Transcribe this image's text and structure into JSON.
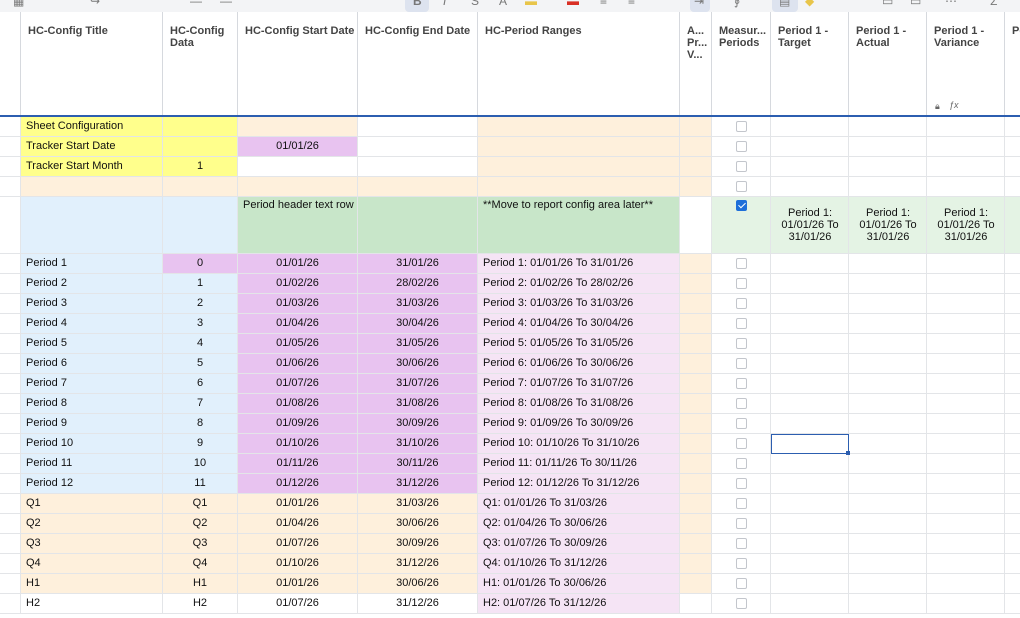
{
  "columns": [
    {
      "title": "",
      "width": 21
    },
    {
      "title": "HC-Config Title",
      "width": 142
    },
    {
      "title": "HC-Config Data",
      "width": 75
    },
    {
      "title": "HC-Config Start Date",
      "width": 120
    },
    {
      "title": "HC-Config End Date",
      "width": 120
    },
    {
      "title": "HC-Period Ranges",
      "width": 202
    },
    {
      "title": "A... Pr... V...",
      "width": 32
    },
    {
      "title": "Measur... Periods",
      "width": 59
    },
    {
      "title": "Period 1 - Target",
      "width": 78
    },
    {
      "title": "Period 1 - Actual",
      "width": 78
    },
    {
      "title": "Period 1 - Variance",
      "width": 78
    },
    {
      "title": "Pe Pr",
      "width": 40
    }
  ],
  "header_icons": {
    "lock": "lock-icon",
    "formula": "formula-icon"
  },
  "fills": {
    "yellow": "#ffff8c",
    "peach": "#fef0dc",
    "lavender": "#e8c3f0",
    "lightblue": "#e1f0fc",
    "green": "#c8e6c9",
    "pinklight": "#f5e4f5",
    "greenlight": "#e4f3e4",
    "white": "#ffffff"
  },
  "period_header_label": "Period 1: 01/01/26 To 31/01/26",
  "rows": [
    {
      "h": 20,
      "cb": false,
      "period": false,
      "cells": [
        {
          "t": "",
          "f": "white"
        },
        {
          "t": "Sheet Configuration",
          "f": "yellow",
          "a": "left"
        },
        {
          "t": "",
          "f": "yellow"
        },
        {
          "t": "",
          "f": "peach"
        },
        {
          "t": "",
          "f": "white"
        },
        {
          "t": "",
          "f": "peach"
        },
        {
          "t": "",
          "f": "peach"
        }
      ]
    },
    {
      "h": 20,
      "cb": false,
      "period": false,
      "cells": [
        {
          "t": "",
          "f": "white"
        },
        {
          "t": "Tracker Start Date",
          "f": "yellow",
          "a": "left"
        },
        {
          "t": "",
          "f": "yellow"
        },
        {
          "t": "01/01/26",
          "f": "lavender",
          "a": "center"
        },
        {
          "t": "",
          "f": "white"
        },
        {
          "t": "",
          "f": "peach"
        },
        {
          "t": "",
          "f": "peach"
        }
      ]
    },
    {
      "h": 20,
      "cb": false,
      "period": false,
      "cells": [
        {
          "t": "",
          "f": "white"
        },
        {
          "t": "Tracker Start Month",
          "f": "yellow",
          "a": "left"
        },
        {
          "t": "1",
          "f": "yellow",
          "a": "center"
        },
        {
          "t": "",
          "f": "white"
        },
        {
          "t": "",
          "f": "white"
        },
        {
          "t": "",
          "f": "peach"
        },
        {
          "t": "",
          "f": "peach"
        }
      ]
    },
    {
      "h": 20,
      "cb": false,
      "period": false,
      "cells": [
        {
          "t": "",
          "f": "white"
        },
        {
          "t": "",
          "f": "peach"
        },
        {
          "t": "",
          "f": "peach"
        },
        {
          "t": "",
          "f": "peach"
        },
        {
          "t": "",
          "f": "peach"
        },
        {
          "t": "",
          "f": "peach"
        },
        {
          "t": "",
          "f": "peach"
        }
      ]
    },
    {
      "h": 57,
      "cb": true,
      "period": true,
      "cells": [
        {
          "t": "",
          "f": "white"
        },
        {
          "t": "",
          "f": "lightblue"
        },
        {
          "t": "",
          "f": "lightblue"
        },
        {
          "t": "Period header text row",
          "f": "green",
          "a": "top"
        },
        {
          "t": "",
          "f": "green"
        },
        {
          "t": "**Move to report config area later**",
          "f": "green",
          "a": "top"
        },
        {
          "t": "",
          "f": "white"
        },
        {
          "t": "",
          "f": "greenlight"
        },
        {
          "t": "",
          "f": "greenlight"
        },
        {
          "t": "",
          "f": "greenlight"
        },
        {
          "t": "",
          "f": "greenlight"
        },
        {
          "t": "",
          "f": "greenlight"
        }
      ]
    },
    {
      "h": 20,
      "cb": false,
      "period": false,
      "cells": [
        {
          "t": "",
          "f": "white"
        },
        {
          "t": "Period 1",
          "f": "lightblue",
          "a": "left"
        },
        {
          "t": "0",
          "f": "lavender",
          "a": "center"
        },
        {
          "t": "01/01/26",
          "f": "lavender",
          "a": "center"
        },
        {
          "t": "31/01/26",
          "f": "lavender",
          "a": "center"
        },
        {
          "t": "Period 1: 01/01/26 To 31/01/26",
          "f": "pinklight",
          "a": "left"
        },
        {
          "t": "",
          "f": "peach"
        }
      ]
    },
    {
      "h": 20,
      "cb": false,
      "period": false,
      "cells": [
        {
          "t": "",
          "f": "white"
        },
        {
          "t": "Period 2",
          "f": "lightblue",
          "a": "left"
        },
        {
          "t": "1",
          "f": "lightblue",
          "a": "center"
        },
        {
          "t": "01/02/26",
          "f": "lavender",
          "a": "center"
        },
        {
          "t": "28/02/26",
          "f": "lavender",
          "a": "center"
        },
        {
          "t": "Period 2: 01/02/26 To 28/02/26",
          "f": "pinklight",
          "a": "left"
        },
        {
          "t": "",
          "f": "peach"
        }
      ]
    },
    {
      "h": 20,
      "cb": false,
      "period": false,
      "cells": [
        {
          "t": "",
          "f": "white"
        },
        {
          "t": "Period 3",
          "f": "lightblue",
          "a": "left"
        },
        {
          "t": "2",
          "f": "lightblue",
          "a": "center"
        },
        {
          "t": "01/03/26",
          "f": "lavender",
          "a": "center"
        },
        {
          "t": "31/03/26",
          "f": "lavender",
          "a": "center"
        },
        {
          "t": "Period 3: 01/03/26 To 31/03/26",
          "f": "pinklight",
          "a": "left"
        },
        {
          "t": "",
          "f": "peach"
        }
      ]
    },
    {
      "h": 20,
      "cb": false,
      "period": false,
      "cells": [
        {
          "t": "",
          "f": "white"
        },
        {
          "t": "Period 4",
          "f": "lightblue",
          "a": "left"
        },
        {
          "t": "3",
          "f": "lightblue",
          "a": "center"
        },
        {
          "t": "01/04/26",
          "f": "lavender",
          "a": "center"
        },
        {
          "t": "30/04/26",
          "f": "lavender",
          "a": "center"
        },
        {
          "t": "Period 4: 01/04/26 To 30/04/26",
          "f": "pinklight",
          "a": "left"
        },
        {
          "t": "",
          "f": "peach"
        }
      ]
    },
    {
      "h": 20,
      "cb": false,
      "period": false,
      "cells": [
        {
          "t": "",
          "f": "white"
        },
        {
          "t": "Period 5",
          "f": "lightblue",
          "a": "left"
        },
        {
          "t": "4",
          "f": "lightblue",
          "a": "center"
        },
        {
          "t": "01/05/26",
          "f": "lavender",
          "a": "center"
        },
        {
          "t": "31/05/26",
          "f": "lavender",
          "a": "center"
        },
        {
          "t": "Period 5: 01/05/26 To 31/05/26",
          "f": "pinklight",
          "a": "left"
        },
        {
          "t": "",
          "f": "peach"
        }
      ]
    },
    {
      "h": 20,
      "cb": false,
      "period": false,
      "cells": [
        {
          "t": "",
          "f": "white"
        },
        {
          "t": "Period 6",
          "f": "lightblue",
          "a": "left"
        },
        {
          "t": "5",
          "f": "lightblue",
          "a": "center"
        },
        {
          "t": "01/06/26",
          "f": "lavender",
          "a": "center"
        },
        {
          "t": "30/06/26",
          "f": "lavender",
          "a": "center"
        },
        {
          "t": "Period 6: 01/06/26 To 30/06/26",
          "f": "pinklight",
          "a": "left"
        },
        {
          "t": "",
          "f": "peach"
        }
      ]
    },
    {
      "h": 20,
      "cb": false,
      "period": false,
      "cells": [
        {
          "t": "",
          "f": "white"
        },
        {
          "t": "Period 7",
          "f": "lightblue",
          "a": "left"
        },
        {
          "t": "6",
          "f": "lightblue",
          "a": "center"
        },
        {
          "t": "01/07/26",
          "f": "lavender",
          "a": "center"
        },
        {
          "t": "31/07/26",
          "f": "lavender",
          "a": "center"
        },
        {
          "t": "Period 7: 01/07/26 To 31/07/26",
          "f": "pinklight",
          "a": "left"
        },
        {
          "t": "",
          "f": "peach"
        }
      ]
    },
    {
      "h": 20,
      "cb": false,
      "period": false,
      "cells": [
        {
          "t": "",
          "f": "white"
        },
        {
          "t": "Period 8",
          "f": "lightblue",
          "a": "left"
        },
        {
          "t": "7",
          "f": "lightblue",
          "a": "center"
        },
        {
          "t": "01/08/26",
          "f": "lavender",
          "a": "center"
        },
        {
          "t": "31/08/26",
          "f": "lavender",
          "a": "center"
        },
        {
          "t": "Period 8: 01/08/26 To 31/08/26",
          "f": "pinklight",
          "a": "left"
        },
        {
          "t": "",
          "f": "peach"
        }
      ]
    },
    {
      "h": 20,
      "cb": false,
      "period": false,
      "cells": [
        {
          "t": "",
          "f": "white"
        },
        {
          "t": "Period 9",
          "f": "lightblue",
          "a": "left"
        },
        {
          "t": "8",
          "f": "lightblue",
          "a": "center"
        },
        {
          "t": "01/09/26",
          "f": "lavender",
          "a": "center"
        },
        {
          "t": "30/09/26",
          "f": "lavender",
          "a": "center"
        },
        {
          "t": "Period 9: 01/09/26 To 30/09/26",
          "f": "pinklight",
          "a": "left"
        },
        {
          "t": "",
          "f": "peach"
        }
      ]
    },
    {
      "h": 20,
      "cb": false,
      "period": false,
      "cells": [
        {
          "t": "",
          "f": "white"
        },
        {
          "t": "Period 10",
          "f": "lightblue",
          "a": "left"
        },
        {
          "t": "9",
          "f": "lightblue",
          "a": "center"
        },
        {
          "t": "01/10/26",
          "f": "lavender",
          "a": "center"
        },
        {
          "t": "31/10/26",
          "f": "lavender",
          "a": "center"
        },
        {
          "t": "Period 10: 01/10/26 To 31/10/26",
          "f": "pinklight",
          "a": "left"
        },
        {
          "t": "",
          "f": "peach"
        }
      ]
    },
    {
      "h": 20,
      "cb": false,
      "period": false,
      "cells": [
        {
          "t": "",
          "f": "white"
        },
        {
          "t": "Period 11",
          "f": "lightblue",
          "a": "left"
        },
        {
          "t": "10",
          "f": "lightblue",
          "a": "center"
        },
        {
          "t": "01/11/26",
          "f": "lavender",
          "a": "center"
        },
        {
          "t": "30/11/26",
          "f": "lavender",
          "a": "center"
        },
        {
          "t": "Period 11: 01/11/26 To 30/11/26",
          "f": "pinklight",
          "a": "left"
        },
        {
          "t": "",
          "f": "peach"
        }
      ]
    },
    {
      "h": 20,
      "cb": false,
      "period": false,
      "cells": [
        {
          "t": "",
          "f": "white"
        },
        {
          "t": "Period 12",
          "f": "lightblue",
          "a": "left"
        },
        {
          "t": "11",
          "f": "lightblue",
          "a": "center"
        },
        {
          "t": "01/12/26",
          "f": "lavender",
          "a": "center"
        },
        {
          "t": "31/12/26",
          "f": "lavender",
          "a": "center"
        },
        {
          "t": "Period 12: 01/12/26 To 31/12/26",
          "f": "pinklight",
          "a": "left"
        },
        {
          "t": "",
          "f": "peach"
        }
      ]
    },
    {
      "h": 20,
      "cb": false,
      "period": false,
      "cells": [
        {
          "t": "",
          "f": "white"
        },
        {
          "t": "Q1",
          "f": "peach",
          "a": "left"
        },
        {
          "t": "Q1",
          "f": "peach",
          "a": "center"
        },
        {
          "t": "01/01/26",
          "f": "peach",
          "a": "center"
        },
        {
          "t": "31/03/26",
          "f": "peach",
          "a": "center"
        },
        {
          "t": "Q1: 01/01/26 To 31/03/26",
          "f": "pinklight",
          "a": "left"
        },
        {
          "t": "",
          "f": "peach"
        }
      ]
    },
    {
      "h": 20,
      "cb": false,
      "period": false,
      "cells": [
        {
          "t": "",
          "f": "white"
        },
        {
          "t": "Q2",
          "f": "peach",
          "a": "left"
        },
        {
          "t": "Q2",
          "f": "peach",
          "a": "center"
        },
        {
          "t": "01/04/26",
          "f": "peach",
          "a": "center"
        },
        {
          "t": "30/06/26",
          "f": "peach",
          "a": "center"
        },
        {
          "t": "Q2: 01/04/26 To 30/06/26",
          "f": "pinklight",
          "a": "left"
        },
        {
          "t": "",
          "f": "peach"
        }
      ]
    },
    {
      "h": 20,
      "cb": false,
      "period": false,
      "cells": [
        {
          "t": "",
          "f": "white"
        },
        {
          "t": "Q3",
          "f": "peach",
          "a": "left"
        },
        {
          "t": "Q3",
          "f": "peach",
          "a": "center"
        },
        {
          "t": "01/07/26",
          "f": "peach",
          "a": "center"
        },
        {
          "t": "30/09/26",
          "f": "peach",
          "a": "center"
        },
        {
          "t": "Q3: 01/07/26 To 30/09/26",
          "f": "pinklight",
          "a": "left"
        },
        {
          "t": "",
          "f": "peach"
        }
      ]
    },
    {
      "h": 20,
      "cb": false,
      "period": false,
      "cells": [
        {
          "t": "",
          "f": "white"
        },
        {
          "t": "Q4",
          "f": "peach",
          "a": "left"
        },
        {
          "t": "Q4",
          "f": "peach",
          "a": "center"
        },
        {
          "t": "01/10/26",
          "f": "peach",
          "a": "center"
        },
        {
          "t": "31/12/26",
          "f": "peach",
          "a": "center"
        },
        {
          "t": "Q4: 01/10/26 To 31/12/26",
          "f": "pinklight",
          "a": "left"
        },
        {
          "t": "",
          "f": "peach"
        }
      ]
    },
    {
      "h": 20,
      "cb": false,
      "period": false,
      "cells": [
        {
          "t": "",
          "f": "white"
        },
        {
          "t": "H1",
          "f": "peach",
          "a": "left"
        },
        {
          "t": "H1",
          "f": "peach",
          "a": "center"
        },
        {
          "t": "01/01/26",
          "f": "peach",
          "a": "center"
        },
        {
          "t": "30/06/26",
          "f": "peach",
          "a": "center"
        },
        {
          "t": "H1: 01/01/26 To 30/06/26",
          "f": "pinklight",
          "a": "left"
        },
        {
          "t": "",
          "f": "peach"
        }
      ]
    },
    {
      "h": 20,
      "cb": false,
      "period": false,
      "cells": [
        {
          "t": "",
          "f": "white"
        },
        {
          "t": "H2",
          "f": "white",
          "a": "left"
        },
        {
          "t": "H2",
          "f": "white",
          "a": "center"
        },
        {
          "t": "01/07/26",
          "f": "white",
          "a": "center"
        },
        {
          "t": "31/12/26",
          "f": "white",
          "a": "center"
        },
        {
          "t": "H2: 01/07/26 To 31/12/26",
          "f": "pinklight",
          "a": "left"
        },
        {
          "t": "",
          "f": "white"
        }
      ]
    }
  ]
}
